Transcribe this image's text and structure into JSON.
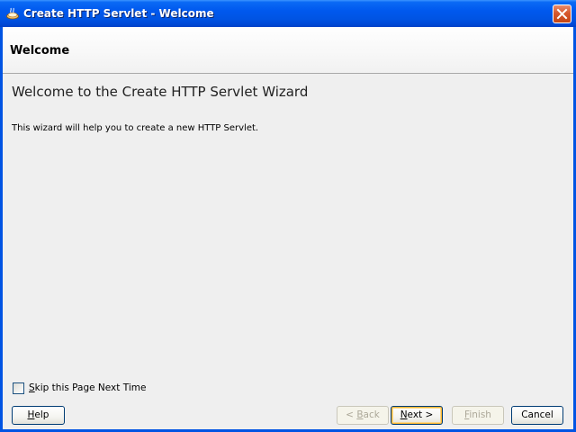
{
  "window": {
    "title": "Create HTTP Servlet - Welcome",
    "icon": "jdeveloper-app-icon",
    "close_icon": "close-icon"
  },
  "header": {
    "title": "Welcome"
  },
  "main": {
    "heading": "Welcome to the Create HTTP Servlet Wizard",
    "description": "This wizard will help you to create a new HTTP Servlet."
  },
  "skip": {
    "label_mnemonic": "S",
    "label_rest": "kip this Page Next Time",
    "checked": false
  },
  "buttons": {
    "help": {
      "mnemonic": "H",
      "rest": "elp"
    },
    "back": {
      "prefix": "< ",
      "mnemonic": "B",
      "rest": "ack",
      "enabled": false
    },
    "next": {
      "mnemonic": "N",
      "rest": "ext >",
      "enabled": true
    },
    "finish": {
      "mnemonic": "F",
      "rest": "inish",
      "enabled": false
    },
    "cancel": {
      "label": "Cancel"
    }
  },
  "colors": {
    "titlebar": "#0054e3",
    "client_bg": "#efefef",
    "close_button": "#d7582d",
    "default_button_highlight": "#f8b636"
  }
}
